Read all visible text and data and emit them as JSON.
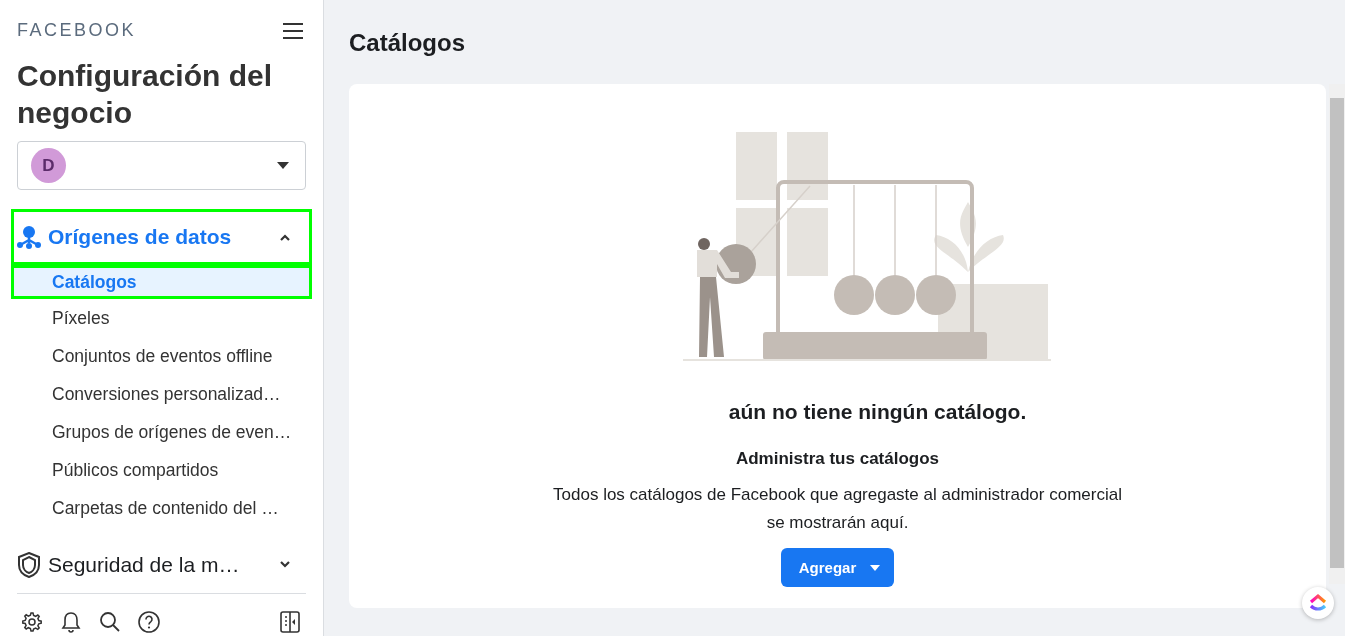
{
  "sidebar": {
    "brand": "FACEBOOK",
    "title": "Configuración del negocio",
    "account": {
      "initial": "D"
    },
    "sections": [
      {
        "label": "Orígenes de datos",
        "kind": "data",
        "expanded": true,
        "highlighted": true,
        "items": [
          {
            "label": "Catálogos",
            "selected": true,
            "highlighted": true
          },
          {
            "label": "Píxeles",
            "selected": false,
            "highlighted": false
          },
          {
            "label": "Conjuntos de eventos offline",
            "selected": false,
            "highlighted": false
          },
          {
            "label": "Conversiones personalizad…",
            "selected": false,
            "highlighted": false
          },
          {
            "label": "Grupos de orígenes de even…",
            "selected": false,
            "highlighted": false
          },
          {
            "label": "Públicos compartidos",
            "selected": false,
            "highlighted": false
          },
          {
            "label": "Carpetas de contenido del …",
            "selected": false,
            "highlighted": false
          }
        ]
      },
      {
        "label": "Seguridad de la m…",
        "kind": "security",
        "expanded": false,
        "highlighted": false
      }
    ]
  },
  "main": {
    "title": "Catálogos",
    "empty_state": {
      "heading": "aún no tiene ningún catálogo.",
      "subheading": "Administra tus catálogos",
      "description": "Todos los catálogos de Facebook que agregaste al administrador comercial se mostrarán aquí.",
      "button": "Agregar"
    }
  }
}
